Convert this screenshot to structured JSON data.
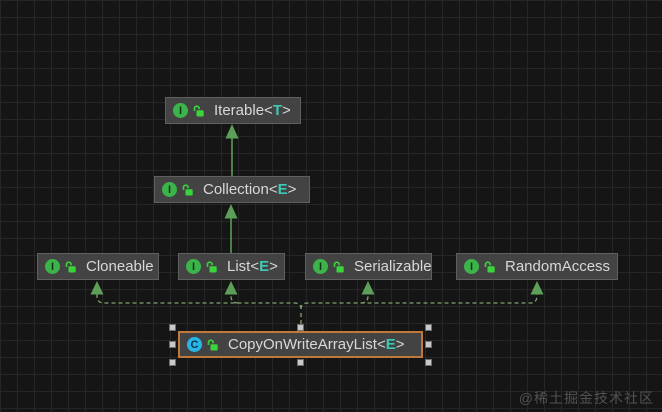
{
  "diagram": {
    "nodes": {
      "iterable": {
        "icon": "I",
        "kind": "interface",
        "label": "Iterable",
        "lt": "<",
        "param": "T",
        "gt": ">"
      },
      "collection": {
        "icon": "I",
        "kind": "interface",
        "label": "Collection",
        "lt": "<",
        "param": "E",
        "gt": ">"
      },
      "cloneable": {
        "icon": "I",
        "kind": "interface",
        "label": "Cloneable"
      },
      "list": {
        "icon": "I",
        "kind": "interface",
        "label": "List",
        "lt": "<",
        "param": "E",
        "gt": ">"
      },
      "serializable": {
        "icon": "I",
        "kind": "interface",
        "label": "Serializable"
      },
      "randomaccess": {
        "icon": "I",
        "kind": "interface",
        "label": "RandomAccess"
      },
      "cowal": {
        "icon": "C",
        "kind": "class",
        "label": "CopyOnWriteArrayList",
        "lt": "<",
        "param": "E",
        "gt": ">",
        "selected": true
      }
    },
    "edges": [
      {
        "from": "Collection<E>",
        "to": "Iterable<T>",
        "type": "extends",
        "style": "solid-green"
      },
      {
        "from": "List<E>",
        "to": "Collection<E>",
        "type": "extends",
        "style": "solid-green"
      },
      {
        "from": "CopyOnWriteArrayList<E>",
        "to": "Cloneable",
        "type": "implements",
        "style": "dashed-green"
      },
      {
        "from": "CopyOnWriteArrayList<E>",
        "to": "List<E>",
        "type": "implements",
        "style": "dashed-green"
      },
      {
        "from": "CopyOnWriteArrayList<E>",
        "to": "Serializable",
        "type": "implements",
        "style": "dashed-green"
      },
      {
        "from": "CopyOnWriteArrayList<E>",
        "to": "RandomAccess",
        "type": "implements",
        "style": "dashed-green"
      }
    ],
    "colors": {
      "interface_icon": "#3cb44a",
      "class_icon": "#29b5e8",
      "lock_icon": "#3bd33b",
      "solid_edge": "#569e56",
      "dashed_edge": "#7fa470",
      "arrowhead": "#5d9f58",
      "generic_type": "#3ec9b6",
      "selection_border": "#c0793a",
      "node_fill": "#434343"
    }
  },
  "watermark": {
    "text": "@稀土掘金技术社区"
  }
}
